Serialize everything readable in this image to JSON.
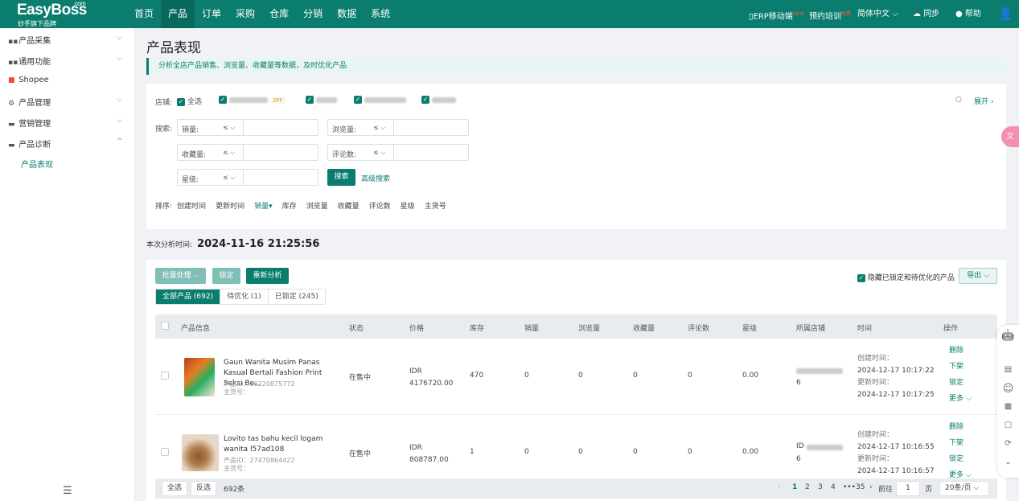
{
  "brand": {
    "name": "EasyBoss",
    "com": ".com",
    "tagline": "妙手旗下品牌"
  },
  "nav": [
    "首页",
    "产品",
    "订单",
    "采购",
    "仓库",
    "分销",
    "数据",
    "系统"
  ],
  "nav_active_index": 1,
  "topright": {
    "mobile": "ERP移动端",
    "mobile_sup": "NEW",
    "training": "预约培训",
    "training_sup": "免费",
    "lang": "简体中文",
    "sync": "同步",
    "help": "帮助"
  },
  "sidebar": {
    "items": [
      {
        "label": "产品采集",
        "icon": "grid-icon",
        "chev": "⌵"
      },
      {
        "label": "通用功能",
        "icon": "grid-icon",
        "chev": "⌵"
      },
      {
        "label": "Shopee",
        "icon": "shopee-icon",
        "chev": ""
      },
      {
        "label": "产品管理",
        "icon": "gear-icon",
        "chev": "⌵"
      },
      {
        "label": "营销管理",
        "icon": "monitor-icon",
        "chev": "⌵"
      },
      {
        "label": "产品诊断",
        "icon": "monitor-icon",
        "chev": "^"
      }
    ],
    "sub_active": "产品表现"
  },
  "page": {
    "title": "产品表现",
    "banner": "分析全店产品销售、浏览量、收藏量等数据，及时优化产品"
  },
  "filters": {
    "shop_label": "店铺:",
    "select_all": "全选",
    "tag": "3PF",
    "expand": "展开",
    "search_label": "搜索:",
    "fields": [
      {
        "label": "销量:",
        "op": "≤"
      },
      {
        "label": "浏览量:",
        "op": "≤"
      },
      {
        "label": "收藏量:",
        "op": "≤"
      },
      {
        "label": "评论数:",
        "op": "≤"
      },
      {
        "label": "星级:",
        "op": "≤"
      }
    ],
    "search_btn": "搜索",
    "adv_search": "高级搜索",
    "sort_label": "排序:",
    "sort_items": [
      "创建时间",
      "更新时间",
      "销量▾",
      "库存",
      "浏览量",
      "收藏量",
      "评论数",
      "星级",
      "主货号"
    ]
  },
  "analysis": {
    "label": "本次分析时间:",
    "time": "2024-11-16 21:25:56"
  },
  "toolbar": {
    "batch": "批量处理 ⌵",
    "lock": "锁定",
    "reanalyze": "重新分析",
    "hide_label": "隐藏已锁定和待优化的产品",
    "export": "导出 ⌵"
  },
  "tabs": [
    "全部产品 (692)",
    "待优化 (1)",
    "已锁定 (245)"
  ],
  "columns": [
    "产品信息",
    "状态",
    "价格",
    "库存",
    "销量",
    "浏览量",
    "收藏量",
    "评论数",
    "星级",
    "所属店铺",
    "时间",
    "操作"
  ],
  "rows": [
    {
      "name": "Gaun Wanita Musim Panas Kasual Bertali Fashion Print Seksi Be...",
      "pid": "产品ID：26220875772",
      "sku": "主货号：",
      "status": "在售中",
      "price": "IDR 4176720.00",
      "stock": "470",
      "sales": "0",
      "views": "0",
      "favs": "0",
      "reviews": "0",
      "rating": "0.00",
      "shop": "6",
      "created_label": "创建时间：",
      "created": "2024-12-17 10:17:22",
      "updated_label": "更新时间：",
      "updated": "2024-12-17 10:17:25",
      "ops": [
        "删除",
        "下架",
        "锁定",
        "更多 ⌵"
      ]
    },
    {
      "name": "Lovito tas bahu kecil logam wanita l57ad108",
      "pid": "产品ID：27470864422",
      "sku": "主货号：",
      "status": "在售中",
      "price": "IDR 808787.00",
      "stock": "1",
      "sales": "0",
      "views": "0",
      "favs": "0",
      "reviews": "0",
      "rating": "0.00",
      "shop_prefix": "ID",
      "shop": "6",
      "created_label": "创建时间：",
      "created": "2024-12-17 10:16:55",
      "updated_label": "更新时间：",
      "updated": "2024-12-17 10:16:57",
      "ops": [
        "删除",
        "下架",
        "锁定",
        "更多 ⌵"
      ]
    }
  ],
  "footer": {
    "select_all": "全选",
    "invert": "反选",
    "count": "692条",
    "pages": [
      "1",
      "2",
      "3",
      "4",
      "•••",
      "35"
    ],
    "goto": "前往",
    "goto_val": "1",
    "page_unit": "页",
    "page_size": "20条/页 ⌵"
  },
  "colors": {
    "primary": "#0a7d6e",
    "topbar": "#0a7d6e"
  }
}
